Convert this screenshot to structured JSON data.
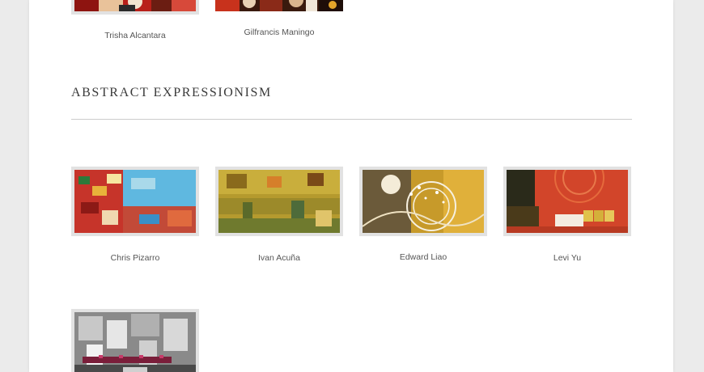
{
  "top_row": [
    {
      "artist": "Trisha Alcantara"
    },
    {
      "artist": "Gilfrancis Maningo"
    }
  ],
  "section": {
    "title": "ABSTRACT EXPRESSIONISM",
    "artworks": [
      {
        "artist": "Chris Pizarro"
      },
      {
        "artist": "Ivan Acuña"
      },
      {
        "artist": "Edward Liao"
      },
      {
        "artist": "Levi Yu"
      },
      {
        "artist": ""
      }
    ]
  },
  "colors": {
    "page_background": "#ebebeb",
    "content_background": "#ffffff",
    "thumbnail_frame": "#e2e2e2",
    "caption_text": "#555555",
    "heading_text": "#3a3a3a",
    "divider": "#cccccc"
  }
}
